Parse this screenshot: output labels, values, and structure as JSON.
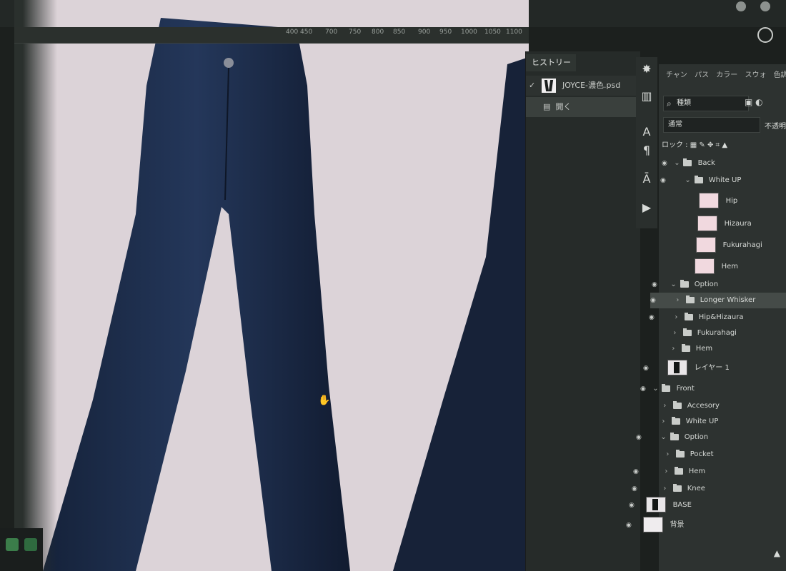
{
  "ruler": {
    "ticks": [
      "400",
      "450",
      "700",
      "750",
      "800",
      "850",
      "900",
      "950",
      "1000",
      "1050",
      "1100"
    ]
  },
  "history": {
    "tab_label": "ヒストリー",
    "snapshot_name": "JOYCE-濃色.psd",
    "state_name": "開く"
  },
  "layers_panel": {
    "tabs": [
      "チャン",
      "パス",
      "カラー",
      "スウォ",
      "色調補"
    ],
    "filter_label": "種類",
    "blend_mode": "通常",
    "opacity_label": "不透明",
    "lock_label": "ロック :",
    "layers": [
      {
        "name": "Back",
        "kind": "folder",
        "expanded": true
      },
      {
        "name": "White UP",
        "kind": "folder",
        "expanded": true
      },
      {
        "name": "Hip",
        "kind": "layer"
      },
      {
        "name": "Hizaura",
        "kind": "layer"
      },
      {
        "name": "Fukurahagi",
        "kind": "layer"
      },
      {
        "name": "Hem",
        "kind": "layer"
      },
      {
        "name": "Option",
        "kind": "folder",
        "expanded": true
      },
      {
        "name": "Longer Whisker",
        "kind": "folder",
        "selected": true
      },
      {
        "name": "Hip&Hizaura",
        "kind": "folder"
      },
      {
        "name": "Fukurahagi",
        "kind": "folder"
      },
      {
        "name": "Hem",
        "kind": "folder"
      },
      {
        "name": "レイヤー 1",
        "kind": "layer"
      },
      {
        "name": "Front",
        "kind": "folder",
        "expanded": true
      },
      {
        "name": "Accesory",
        "kind": "folder"
      },
      {
        "name": "White UP",
        "kind": "folder"
      },
      {
        "name": "Option",
        "kind": "folder",
        "expanded": true
      },
      {
        "name": "Pocket",
        "kind": "folder"
      },
      {
        "name": "Hem",
        "kind": "folder"
      },
      {
        "name": "Knee",
        "kind": "folder"
      },
      {
        "name": "BASE",
        "kind": "layer"
      },
      {
        "name": "背景",
        "kind": "layer"
      }
    ]
  },
  "colors": {
    "canvas_bg": "#dcd3d8",
    "denim": "#1c2b44",
    "panel_bg": "#2d3230",
    "selected_row": "#454b48"
  }
}
